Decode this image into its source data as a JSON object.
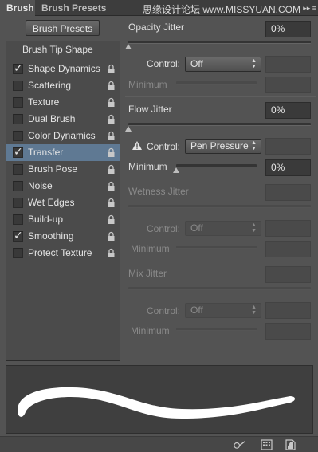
{
  "tabs": [
    {
      "label": "Brush",
      "active": true
    },
    {
      "label": "Brush Presets",
      "active": false
    }
  ],
  "watermark": "思缘设计论坛  www.MISSYUAN.COM",
  "panel_menu": "▸▸  ≡",
  "presets_button": "Brush Presets",
  "list_header": "Brush Tip Shape",
  "list_items": [
    {
      "label": "Shape Dynamics",
      "checked": true,
      "selected": false
    },
    {
      "label": "Scattering",
      "checked": false,
      "selected": false
    },
    {
      "label": "Texture",
      "checked": false,
      "selected": false
    },
    {
      "label": "Dual Brush",
      "checked": false,
      "selected": false
    },
    {
      "label": "Color Dynamics",
      "checked": false,
      "selected": false
    },
    {
      "label": "Transfer",
      "checked": true,
      "selected": true
    },
    {
      "label": "Brush Pose",
      "checked": false,
      "selected": false
    },
    {
      "label": "Noise",
      "checked": false,
      "selected": false
    },
    {
      "label": "Wet Edges",
      "checked": false,
      "selected": false
    },
    {
      "label": "Build-up",
      "checked": false,
      "selected": false
    },
    {
      "label": "Smoothing",
      "checked": true,
      "selected": false
    },
    {
      "label": "Protect Texture",
      "checked": false,
      "selected": false
    }
  ],
  "check_glyph": "✓",
  "opacity": {
    "label": "Opacity Jitter",
    "value": "0%",
    "control_label": "Control:",
    "control_value": "Off",
    "minimum_label": "Minimum"
  },
  "flow": {
    "label": "Flow Jitter",
    "value": "0%",
    "control_label": "Control:",
    "control_value": "Pen Pressure",
    "minimum_label": "Minimum",
    "minimum_value": "0%"
  },
  "wetness": {
    "label": "Wetness Jitter",
    "control_label": "Control:",
    "control_value": "Off",
    "minimum_label": "Minimum"
  },
  "mix": {
    "label": "Mix Jitter",
    "control_label": "Control:",
    "control_value": "Off",
    "minimum_label": "Minimum"
  },
  "select_arrows": "▲▼",
  "colors": {
    "panel_bg": "#535353",
    "selected_row": "#5f7993",
    "stroke": "#ffffff"
  }
}
